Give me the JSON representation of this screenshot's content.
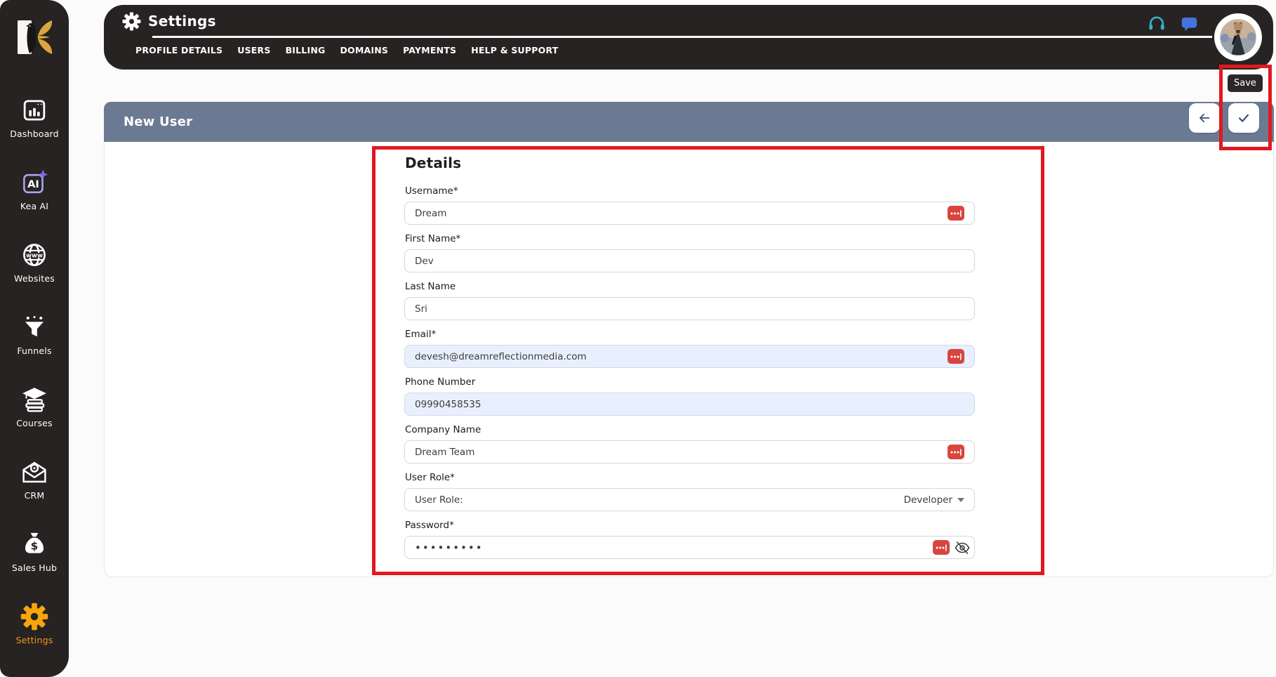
{
  "app": {
    "name": "Kea"
  },
  "sidebar": {
    "items": [
      {
        "label": "Dashboard",
        "icon": "dashboard-icon",
        "active": false
      },
      {
        "label": "Kea AI",
        "icon": "kea-ai-icon",
        "active": false
      },
      {
        "label": "Websites",
        "icon": "websites-icon",
        "active": false
      },
      {
        "label": "Funnels",
        "icon": "funnels-icon",
        "active": false
      },
      {
        "label": "Courses",
        "icon": "courses-icon",
        "active": false
      },
      {
        "label": "CRM",
        "icon": "crm-icon",
        "active": false
      },
      {
        "label": "Sales Hub",
        "icon": "sales-hub-icon",
        "active": false
      },
      {
        "label": "Settings",
        "icon": "settings-gear-icon",
        "active": true
      }
    ]
  },
  "header": {
    "title": "Settings",
    "tabs": [
      "PROFILE DETAILS",
      "USERS",
      "BILLING",
      "DOMAINS",
      "PAYMENTS",
      "HELP & SUPPORT"
    ],
    "icons": [
      "headphones-icon",
      "chat-bubble-icon",
      "user-avatar"
    ]
  },
  "toolbar": {
    "save_tooltip": "Save"
  },
  "panel": {
    "title": "New User"
  },
  "form": {
    "section_title": "Details",
    "fields": [
      {
        "label": "Username*",
        "value": "Dream"
      },
      {
        "label": "First Name*",
        "value": "Dev"
      },
      {
        "label": "Last Name",
        "value": "Sri"
      },
      {
        "label": "Email*",
        "value": "devesh@dreamreflectionmedia.com"
      },
      {
        "label": "Phone Number",
        "value": "09990458535"
      },
      {
        "label": "Company Name",
        "value": "Dream Team"
      },
      {
        "label": "User Role*",
        "prefix": "User Role:",
        "selected": "Developer"
      },
      {
        "label": "Password*",
        "value": "•••••••••"
      }
    ]
  },
  "colors": {
    "header_dark": "#262322",
    "bar_slate": "#6B7A92",
    "annotation_red": "#E0191F",
    "autofill_icon_red": "#D8453E",
    "autofill_field_bg": "#E8F0FE",
    "active_orange": "#F7941E",
    "gear_orange": "#F7A50B",
    "support_teal": "#3AAEC6",
    "chat_blue": "#4373DE",
    "button_icon_slate": "#3D5372"
  }
}
